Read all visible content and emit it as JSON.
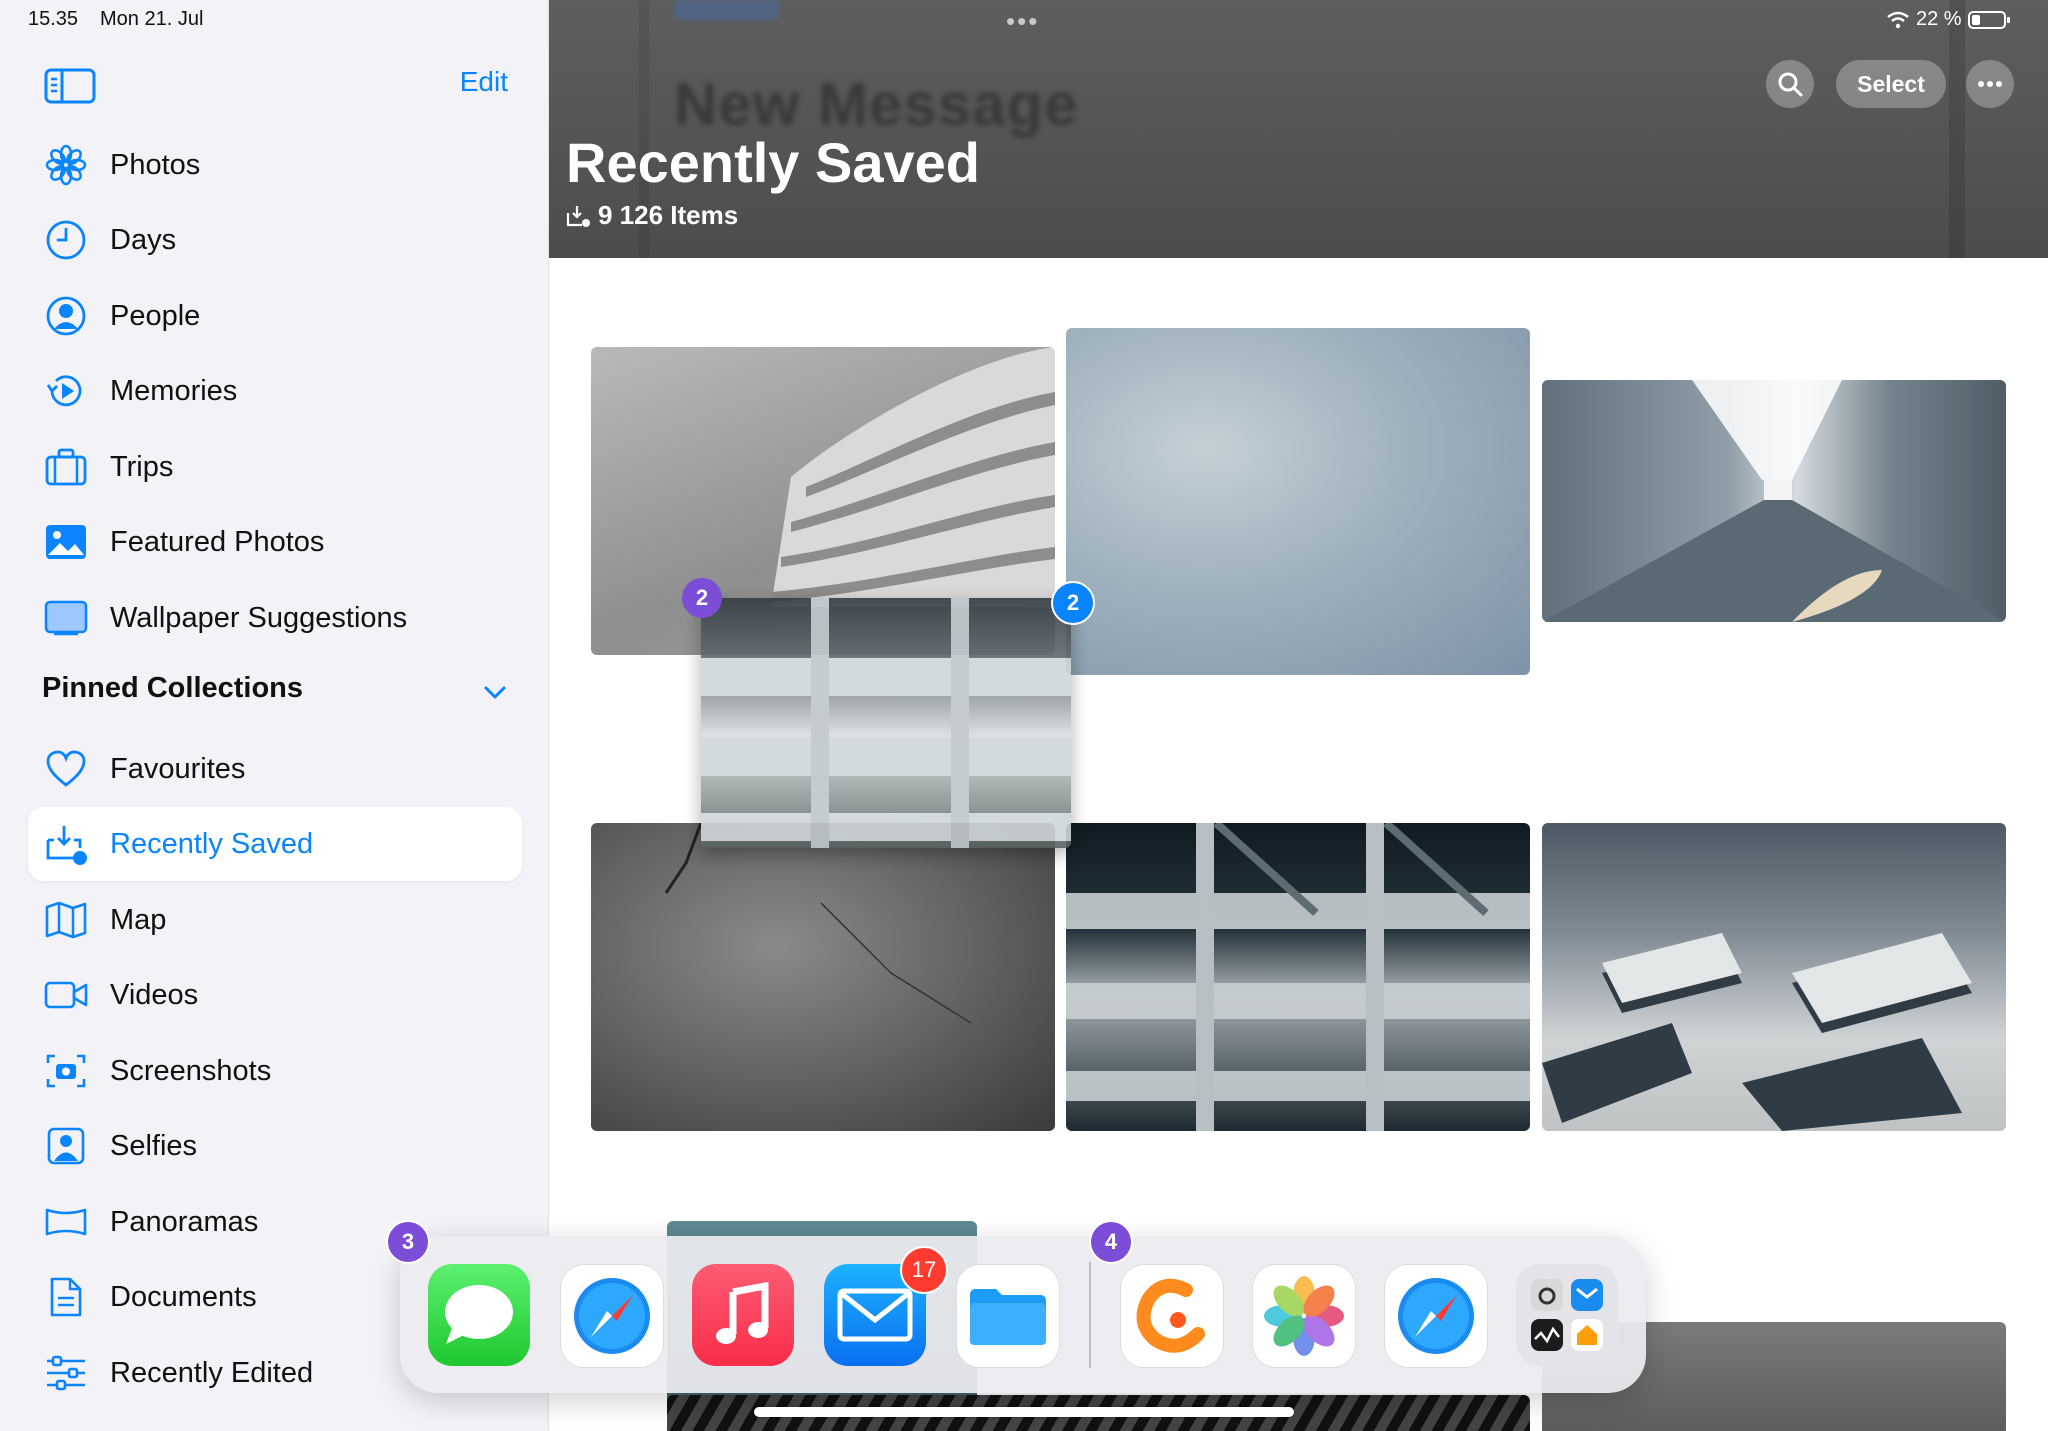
{
  "status_bar": {
    "time": "15.35",
    "date": "Mon 21. Jul",
    "battery": "22 %"
  },
  "sidebar": {
    "edit_label": "Edit",
    "items": [
      {
        "label": "Photos",
        "icon": "flower-icon"
      },
      {
        "label": "Days",
        "icon": "clock-icon"
      },
      {
        "label": "People",
        "icon": "person-circle-icon"
      },
      {
        "label": "Memories",
        "icon": "memories-play-icon"
      },
      {
        "label": "Trips",
        "icon": "suitcase-icon"
      },
      {
        "label": "Featured Photos",
        "icon": "photo-icon"
      },
      {
        "label": "Wallpaper Suggestions",
        "icon": "wallpaper-icon"
      }
    ],
    "section_title": "Pinned Collections",
    "pinned": [
      {
        "label": "Favourites",
        "icon": "heart-icon"
      },
      {
        "label": "Recently Saved",
        "icon": "tray-download-icon",
        "selected": true
      },
      {
        "label": "Map",
        "icon": "map-icon"
      },
      {
        "label": "Videos",
        "icon": "video-icon"
      },
      {
        "label": "Screenshots",
        "icon": "screenshot-icon"
      },
      {
        "label": "Selfies",
        "icon": "selfie-icon"
      },
      {
        "label": "Panoramas",
        "icon": "panorama-icon"
      },
      {
        "label": "Documents",
        "icon": "document-icon"
      },
      {
        "label": "Recently Edited",
        "icon": "sliders-icon"
      }
    ]
  },
  "header": {
    "background_text": "New Message",
    "title": "Recently Saved",
    "subtitle": "9 126 Items",
    "select_label": "Select"
  },
  "drag": {
    "badge_left": "2",
    "badge_right": "2"
  },
  "dock": {
    "left_group_badge": "3",
    "right_group_badge": "4",
    "mail_badge": "17",
    "apps": [
      "Messages",
      "Safari",
      "Music",
      "Mail",
      "Files",
      "Freeform",
      "Photos",
      "Safari",
      "App Library"
    ]
  },
  "colors": {
    "accent": "#0a84ff",
    "sidebar_bg": "#f2f2f7",
    "drag_badge": "#7c4dd6",
    "notification": "#ff3b30"
  }
}
